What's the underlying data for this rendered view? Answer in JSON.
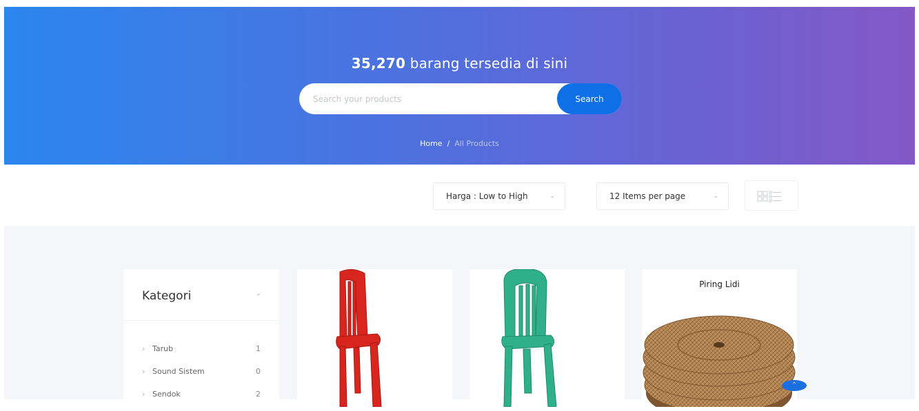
{
  "hero": {
    "count": "35,270",
    "title_suffix": " barang tersedia di sini",
    "search_placeholder": "Search your products",
    "search_button": "Search"
  },
  "breadcrumb": {
    "home": "Home",
    "separator": "/",
    "current": "All Products"
  },
  "toolbar": {
    "sort_label": "Harga : Low to High",
    "per_page_label": "12 Items per page"
  },
  "sidebar": {
    "title": "Kategori",
    "items": [
      {
        "name": "Tarub",
        "count": "1"
      },
      {
        "name": "Sound Sistem",
        "count": "0"
      },
      {
        "name": "Sendok",
        "count": "2"
      }
    ]
  },
  "products": [
    {
      "title": "",
      "color": "#d8261f"
    },
    {
      "title": "",
      "color": "#2fb08a"
    },
    {
      "title": "Piring Lidi",
      "color": "#b48554"
    }
  ],
  "colors": {
    "accent": "#0f6fe6",
    "hero_start": "#2b86ee",
    "hero_end": "#8458c6"
  }
}
